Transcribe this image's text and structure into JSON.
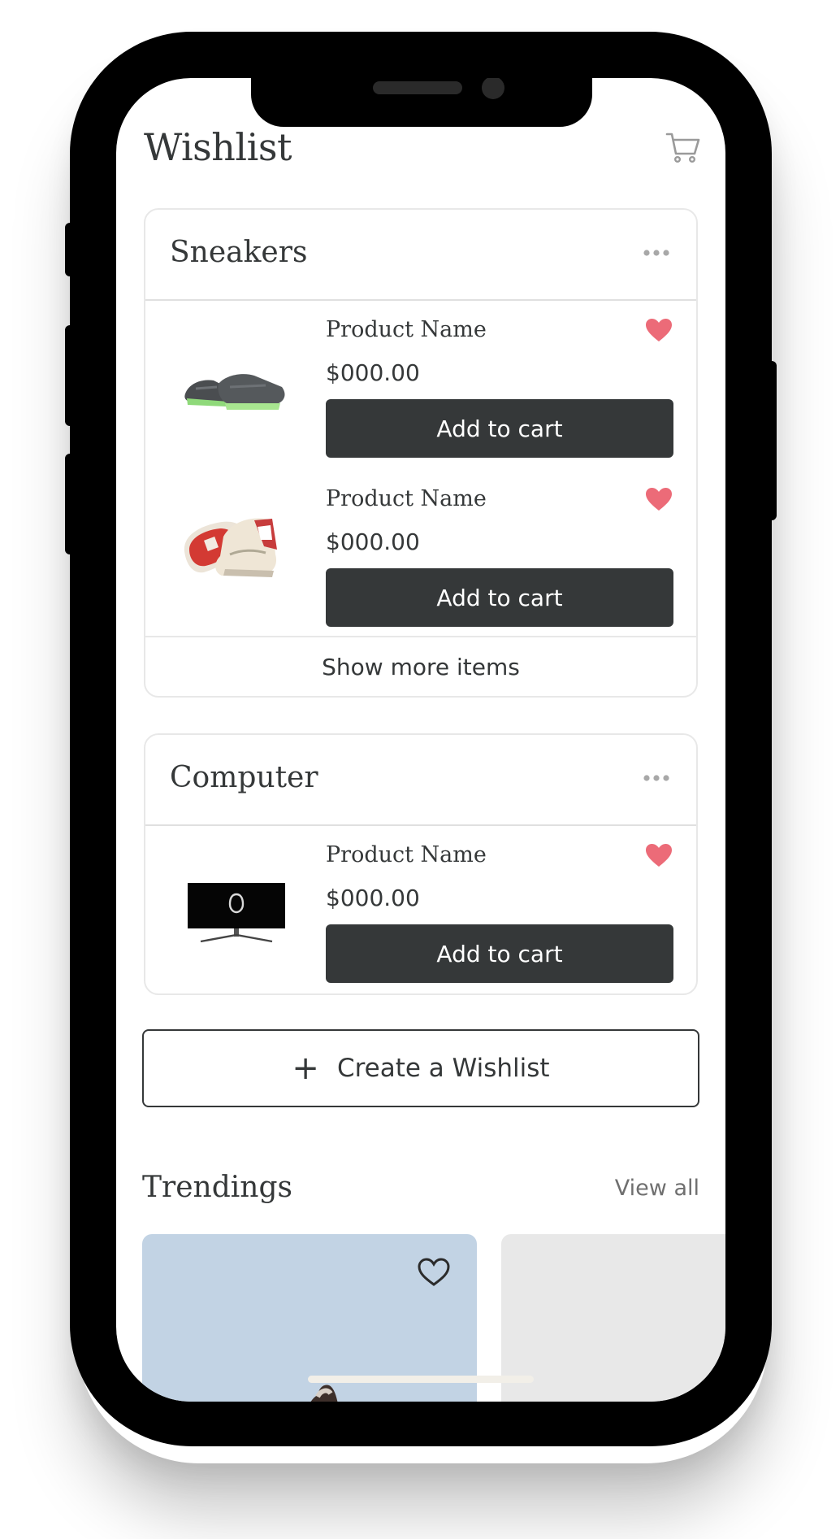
{
  "header": {
    "title": "Wishlist",
    "cart_icon": "cart-icon"
  },
  "wishlists": [
    {
      "title": "Sneakers",
      "items": [
        {
          "name": "Product Name",
          "price": "$000.00",
          "button": "Add to cart",
          "image": "sneaker-pair-grey",
          "favorited": true
        },
        {
          "name": "Product Name",
          "price": "$000.00",
          "button": "Add to cart",
          "image": "sneaker-high-top-red",
          "favorited": true
        }
      ],
      "show_more": "Show more items"
    },
    {
      "title": "Computer",
      "items": [
        {
          "name": "Product Name",
          "price": "$000.00",
          "button": "Add to cart",
          "image": "curved-monitor",
          "favorited": true
        }
      ]
    }
  ],
  "create_button": {
    "label": "Create a Wishlist",
    "icon": "plus-icon"
  },
  "trending": {
    "title": "Trendings",
    "view_all": "View all"
  },
  "colors": {
    "accent_dark": "#353839",
    "heart": "#ec6b78",
    "card_border": "#e8e8e8",
    "trend_card_1": "#c2d3e4",
    "trend_card_2": "#e8e8e8"
  }
}
